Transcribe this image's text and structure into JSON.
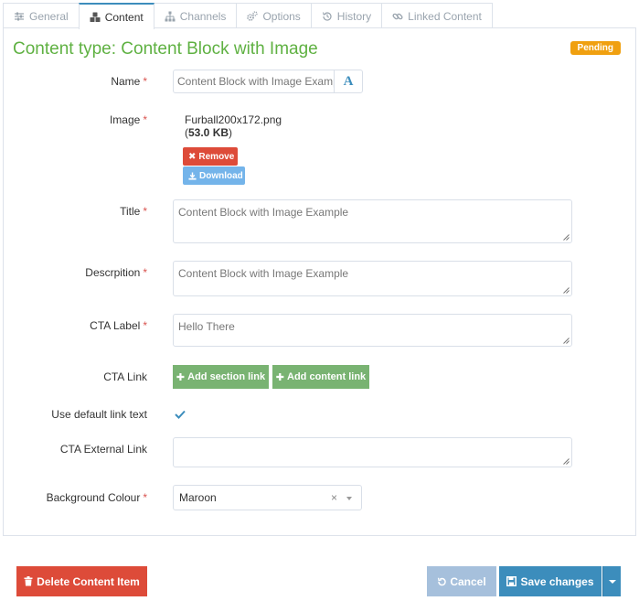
{
  "tabs": [
    {
      "label": "General",
      "icon": "sliders-icon",
      "active": false
    },
    {
      "label": "Content",
      "icon": "cubes-icon",
      "active": true
    },
    {
      "label": "Channels",
      "icon": "sitemap-icon",
      "active": false
    },
    {
      "label": "Options",
      "icon": "cogs-icon",
      "active": false
    },
    {
      "label": "History",
      "icon": "history-icon",
      "active": false
    },
    {
      "label": "Linked Content",
      "icon": "link-icon",
      "active": false
    }
  ],
  "heading": "Content type: Content Block with Image",
  "status_badge": "Pending",
  "form": {
    "name": {
      "label": "Name",
      "value": "Content Block with Image Examp",
      "translate_button": "A"
    },
    "image": {
      "label": "Image",
      "file_name": "Furball200x172.png",
      "file_size_open": "(",
      "file_size": "53.0 KB",
      "file_size_close": ")",
      "remove_label": "Remove",
      "download_label": "Download"
    },
    "title": {
      "label": "Title",
      "value": "Content Block with Image Example"
    },
    "description": {
      "label": "Descrpition",
      "value": "Content Block with Image Example"
    },
    "cta_label": {
      "label": "CTA Label",
      "value": "Hello There"
    },
    "cta_link": {
      "label": "CTA Link",
      "add_section_link": "Add section link",
      "add_content_link": "Add content link"
    },
    "use_default_link_text": {
      "label": "Use default link text",
      "checked": true
    },
    "cta_external_link": {
      "label": "CTA External Link",
      "value": ""
    },
    "background_colour": {
      "label": "Background Colour",
      "value": "Maroon",
      "clear_glyph": "×"
    }
  },
  "required_marker": "*",
  "footer": {
    "delete_label": "Delete Content Item",
    "cancel_label": "Cancel",
    "save_label": "Save changes"
  },
  "colors": {
    "heading": "#5fb142",
    "badge": "#f0a010",
    "danger": "#dd4b39",
    "primary": "#3c8dbc",
    "success": "#79b372",
    "info": "#74b4ea"
  }
}
